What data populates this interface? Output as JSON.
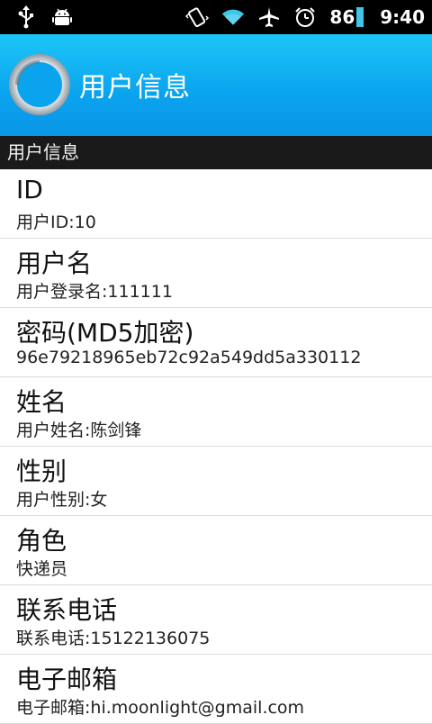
{
  "status_bar": {
    "icons_left": [
      "usb-icon",
      "android-debug-icon"
    ],
    "icons_right": [
      "vibrate-icon",
      "wifi-icon",
      "airplane-mode-icon",
      "alarm-icon"
    ],
    "battery": "86",
    "time": "9:40",
    "battery_color": "#3ec5e8"
  },
  "header": {
    "title": "用户信息",
    "logo_icon": "circle-logo-icon",
    "gradient_top": "#1cc6f7",
    "gradient_bottom": "#0a95e7"
  },
  "section": {
    "title": "用户信息"
  },
  "items": [
    {
      "title": "ID",
      "value": "用户ID:10"
    },
    {
      "title": "用户名",
      "value": "用户登录名:111111"
    },
    {
      "title": "密码(MD5加密)",
      "value": "96e79218965eb72c92a549dd5a330112"
    },
    {
      "title": "姓名",
      "value": "用户姓名:陈剑锋"
    },
    {
      "title": "性别",
      "value": "用户性别:女"
    },
    {
      "title": "角色",
      "value": "快递员"
    },
    {
      "title": "联系电话",
      "value": "联系电话:15122136075"
    },
    {
      "title": "电子邮箱",
      "value": "电子邮箱:hi.moonlight@gmail.com"
    }
  ]
}
